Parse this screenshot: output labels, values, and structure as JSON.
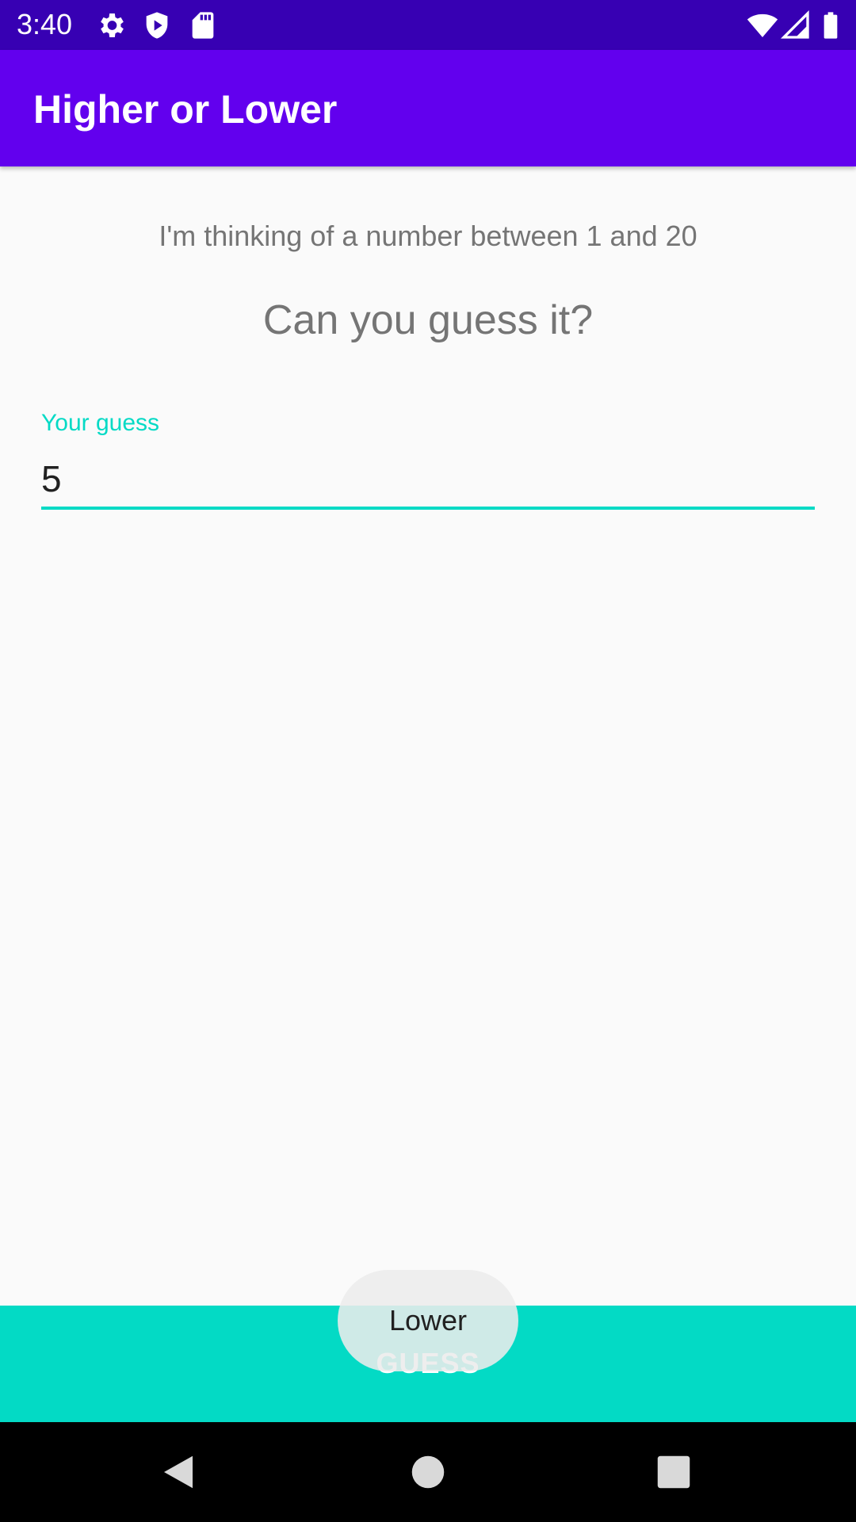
{
  "status_bar": {
    "time": "3:40",
    "icons_left": [
      "gear-icon",
      "shield-icon",
      "sd-card-icon"
    ],
    "icons_right": [
      "wifi-icon",
      "signal-icon",
      "battery-icon"
    ],
    "background": "#3700b3"
  },
  "app_bar": {
    "title": "Higher or Lower",
    "background": "#6200ee"
  },
  "content": {
    "intro": "I'm thinking of a number between 1 and 20",
    "prompt": "Can you guess it?",
    "guess_field": {
      "label": "Your guess",
      "value": "5",
      "accent": "#03dac5"
    }
  },
  "guess_button": {
    "label": "GUESS",
    "background": "#03dac5"
  },
  "toast": {
    "message": "Lower"
  },
  "nav_bar": {
    "buttons": [
      "back-icon",
      "home-icon",
      "recents-icon"
    ]
  }
}
